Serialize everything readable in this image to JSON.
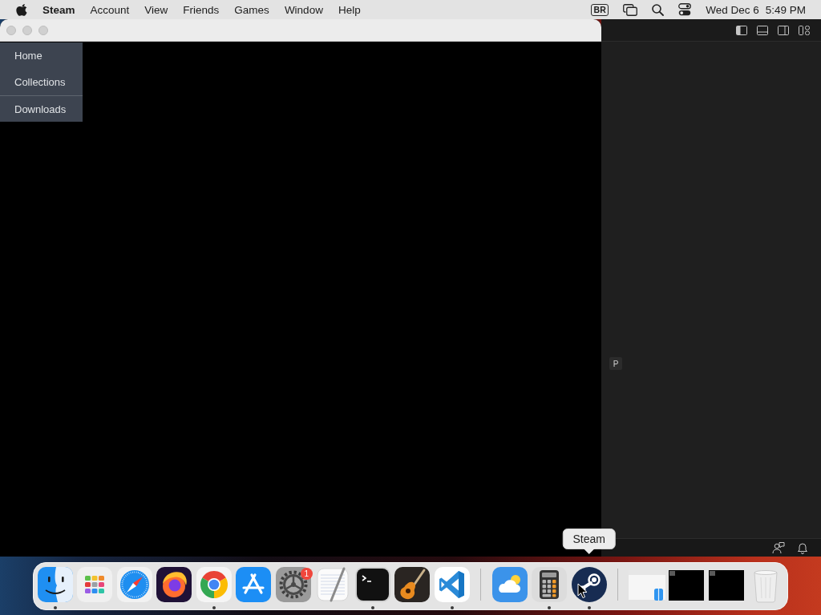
{
  "menu_bar": {
    "app_name": "Steam",
    "menus": [
      "Account",
      "View",
      "Friends",
      "Games",
      "Window",
      "Help"
    ],
    "input_source": "BR",
    "date": "Wed Dec 6",
    "time": "5:49 PM"
  },
  "steam_window": {
    "nav_menu": [
      {
        "label": "Home",
        "divider_before": false
      },
      {
        "label": "Collections",
        "divider_before": false
      },
      {
        "label": "Downloads",
        "divider_before": true
      }
    ]
  },
  "editor_window": {
    "layout_toggles": [
      {
        "kind": "left-panel",
        "on": true
      },
      {
        "kind": "bottom-panel",
        "on": false
      },
      {
        "kind": "right-panel",
        "on": false
      },
      {
        "kind": "layout",
        "on": false
      }
    ],
    "badge": "P",
    "status_icons": [
      {
        "kind": "account"
      },
      {
        "kind": "bell"
      }
    ]
  },
  "dock": {
    "tooltip": "Steam",
    "sections": [
      {
        "items": [
          {
            "kind": "finder",
            "running": true,
            "hovered": false
          },
          {
            "kind": "launchpad",
            "running": false,
            "hovered": false
          },
          {
            "kind": "safari",
            "running": false,
            "hovered": false
          },
          {
            "kind": "firefox",
            "running": false,
            "hovered": false
          },
          {
            "kind": "chrome",
            "running": true,
            "hovered": false
          },
          {
            "kind": "app-store",
            "running": false,
            "hovered": false
          },
          {
            "kind": "settings",
            "running": false,
            "hovered": false,
            "badge": "1"
          },
          {
            "kind": "textedit",
            "running": false,
            "hovered": false
          },
          {
            "kind": "terminal",
            "running": true,
            "hovered": false
          },
          {
            "kind": "garageband",
            "running": false,
            "hovered": false
          },
          {
            "kind": "vscode",
            "running": true,
            "hovered": false
          }
        ]
      },
      {
        "items": [
          {
            "kind": "weather",
            "running": false,
            "hovered": false
          },
          {
            "kind": "calculator",
            "running": true,
            "hovered": false
          },
          {
            "kind": "steam",
            "running": true,
            "hovered": true
          }
        ]
      },
      {
        "items": [
          {
            "kind": "window-light",
            "running": false,
            "hovered": false
          },
          {
            "kind": "window-dark",
            "running": false,
            "hovered": false
          },
          {
            "kind": "window-dark",
            "running": false,
            "hovered": false
          },
          {
            "kind": "trash",
            "running": false,
            "hovered": false
          }
        ]
      }
    ]
  }
}
